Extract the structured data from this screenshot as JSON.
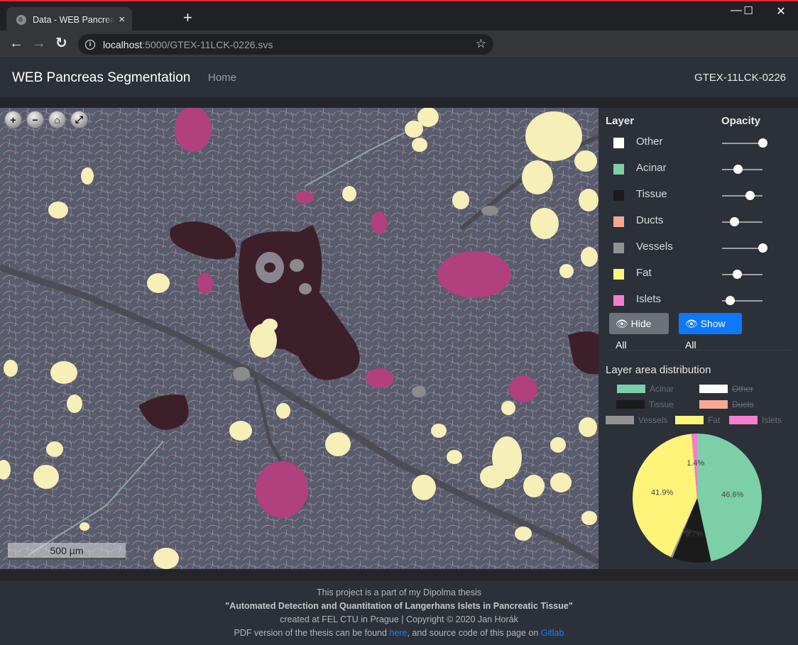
{
  "browser": {
    "tab_title": "Data - WEB Pancreas Segmentation",
    "url_host": "localhost",
    "url_path": ":5000/GTEX-11LCK-0226.svs",
    "new_tab_glyph": "+",
    "close_tab_glyph": "×",
    "icons": {
      "back": "←",
      "forward": "→",
      "reload": "↻",
      "info": "i",
      "star": "☆",
      "minimize": "—",
      "maximize": "☐",
      "close": "✕"
    }
  },
  "navbar": {
    "brand": "WEB Pancreas Segmentation",
    "home_link": "Home",
    "slide_id": "GTEX-11LCK-0226"
  },
  "viewer": {
    "controls": [
      {
        "name": "zoom-in",
        "glyph": "+"
      },
      {
        "name": "zoom-out",
        "glyph": "−"
      },
      {
        "name": "home",
        "glyph": "⌂"
      },
      {
        "name": "fullscreen",
        "glyph": "⤢"
      }
    ],
    "scale_label": "500 µm"
  },
  "panel": {
    "layer_header": "Layer",
    "opacity_header": "Opacity",
    "layers": [
      {
        "name": "Other",
        "color": "#ffffff",
        "opacity": 1.0
      },
      {
        "name": "Acinar",
        "color": "#7ccfa6",
        "opacity": 0.4
      },
      {
        "name": "Tissue",
        "color": "#1b1b1b",
        "opacity": 0.7
      },
      {
        "name": "Ducts",
        "color": "#f7a890",
        "opacity": 0.3
      },
      {
        "name": "Vessels",
        "color": "#929292",
        "opacity": 1.0
      },
      {
        "name": "Fat",
        "color": "#fff47a",
        "opacity": 0.38
      },
      {
        "name": "Islets",
        "color": "#f27fcc",
        "opacity": 0.2
      }
    ],
    "hide_all_label": "Hide All",
    "show_all_label": "Show All",
    "hide_icon": "eye-slash",
    "show_icon": "eye"
  },
  "chart_data": {
    "type": "pie",
    "title": "Layer area distribution",
    "legend": [
      {
        "label": "Acinar",
        "color": "#7ccfa6",
        "hidden": false
      },
      {
        "label": "Other",
        "color": "#ffffff",
        "hidden": true
      },
      {
        "label": "Tissue",
        "color": "#1b1b1b",
        "hidden": false
      },
      {
        "label": "Ducts",
        "color": "#f7a890",
        "hidden": true
      },
      {
        "label": "Vessels",
        "color": "#929292",
        "hidden": false
      },
      {
        "label": "Fat",
        "color": "#fff47a",
        "hidden": false
      },
      {
        "label": "Islets",
        "color": "#f27fcc",
        "hidden": false
      }
    ],
    "legend_position": "top",
    "slices": [
      {
        "label": "Acinar",
        "value": 46.6,
        "color": "#7ccfa6"
      },
      {
        "label": "Tissue",
        "value": 9.7,
        "color": "#1b1b1b"
      },
      {
        "label": "Vessels",
        "value": 0.5,
        "color": "#929292"
      },
      {
        "label": "Fat",
        "value": 41.9,
        "color": "#fff47a"
      },
      {
        "label": "Islets",
        "value": 1.4,
        "color": "#f27fcc"
      }
    ],
    "value_suffix": "%"
  },
  "footer": {
    "line1": "This project is a part of my Dipolma thesis",
    "line2": "\"Automated Detection and Quantitation of Langerhans Islets in Pancreatic Tissue\"",
    "line3": "created at FEL CTU in Prague | Copyright © 2020 Jan Horák",
    "line4_pre": "PDF version of the thesis can be found ",
    "line4_link1": "here",
    "line4_mid": ", and source code of this page on ",
    "line4_link2": "Gitlab"
  }
}
